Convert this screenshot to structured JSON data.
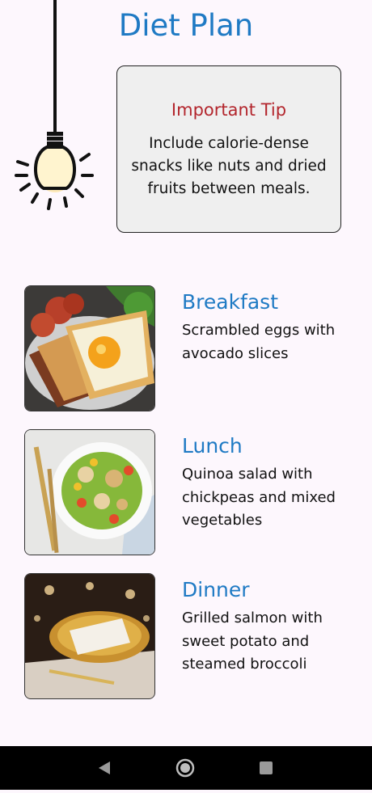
{
  "page": {
    "title": "Diet Plan"
  },
  "tip": {
    "heading": "Important Tip",
    "text": "Include calorie-dense snacks like nuts and dried fruits between meals."
  },
  "meals": [
    {
      "title": "Breakfast",
      "description": "Scrambled eggs with avocado slices",
      "image": "breakfast-photo"
    },
    {
      "title": "Lunch",
      "description": "Quinoa salad with chickpeas and mixed vegetables",
      "image": "lunch-photo"
    },
    {
      "title": "Dinner",
      "description": "Grilled salmon with sweet potato and steamed broccoli",
      "image": "dinner-photo"
    }
  ],
  "navigation": {
    "icons": [
      "back-icon",
      "home-icon",
      "recents-icon"
    ]
  },
  "colors": {
    "accent": "#1f7ac4",
    "tip_heading": "#b3262d",
    "background": "#fdf7fd"
  }
}
